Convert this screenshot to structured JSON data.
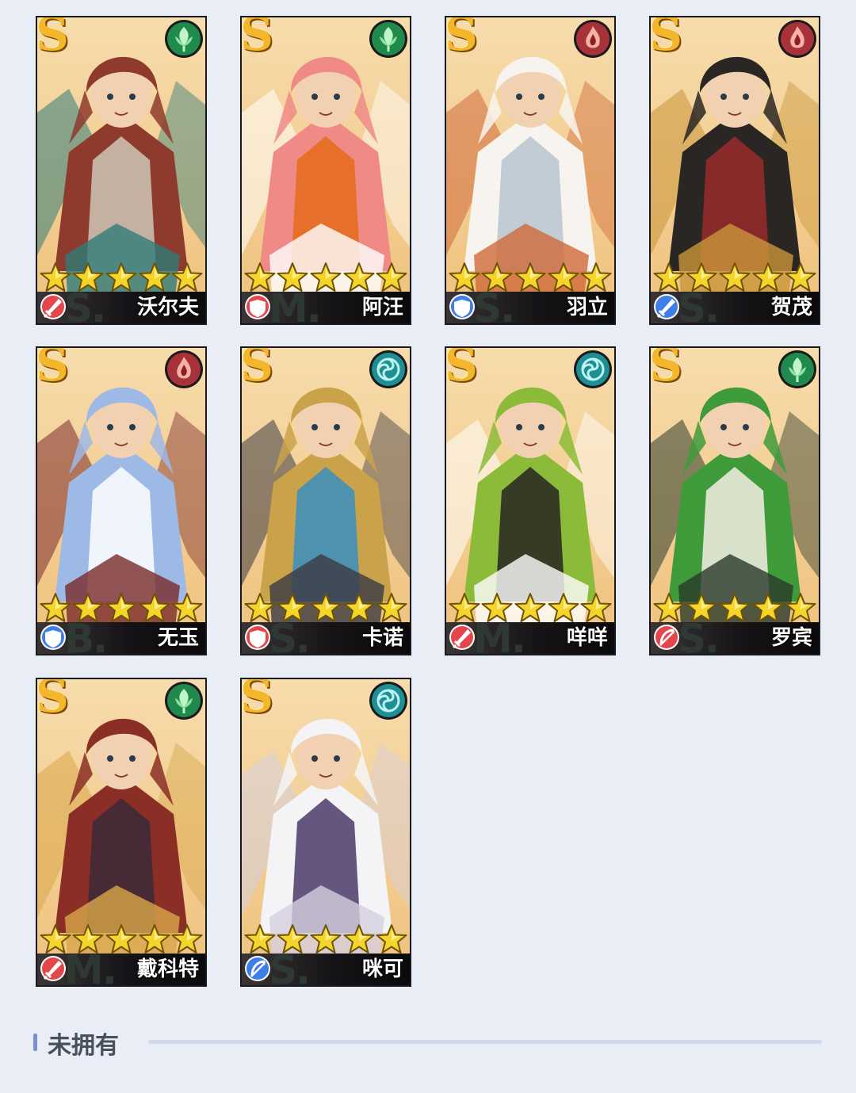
{
  "heroes": [
    {
      "name": "沃尔夫",
      "rank": "S",
      "tier": "S.",
      "element": "nature",
      "element_color": "#1f8a4b",
      "role": "attack",
      "role_color": "#e4464c",
      "stars": 5,
      "art_colors": [
        "#8e3a2c",
        "#cfc7b6",
        "#2f7c7a"
      ]
    },
    {
      "name": "阿汪",
      "rank": "S",
      "tier": "M.",
      "element": "nature",
      "element_color": "#1f8a4b",
      "role": "defense",
      "role_color": "#e4464c",
      "stars": 5,
      "art_colors": [
        "#f08a86",
        "#e46a1a",
        "#ffffff"
      ]
    },
    {
      "name": "羽立",
      "rank": "S",
      "tier": "S.",
      "element": "fire",
      "element_color": "#a8323a",
      "role": "defense",
      "role_color": "#3f7ee6",
      "stars": 5,
      "art_colors": [
        "#f7f4ef",
        "#b8c4cf",
        "#d06a3a"
      ]
    },
    {
      "name": "贺茂",
      "rank": "S",
      "tier": "S.",
      "element": "fire",
      "element_color": "#a8323a",
      "role": "attack",
      "role_color": "#3f7ee6",
      "stars": 5,
      "art_colors": [
        "#2a2624",
        "#9a2b2b",
        "#c9963a"
      ]
    },
    {
      "name": "无玉",
      "rank": "S",
      "tier": "B.",
      "element": "fire",
      "element_color": "#a8323a",
      "role": "defense",
      "role_color": "#3f7ee6",
      "stars": 5,
      "art_colors": [
        "#9db9e6",
        "#ffffff",
        "#7a2a2a"
      ]
    },
    {
      "name": "卡诺",
      "rank": "S",
      "tier": "S.",
      "element": "wind",
      "element_color": "#1e8f93",
      "role": "defense",
      "role_color": "#e4464c",
      "stars": 5,
      "art_colors": [
        "#c9a24a",
        "#3a8fc0",
        "#3b3a44"
      ]
    },
    {
      "name": "咩咩",
      "rank": "S",
      "tier": "M.",
      "element": "wind",
      "element_color": "#1e8f93",
      "role": "attack",
      "role_color": "#e4464c",
      "stars": 5,
      "art_colors": [
        "#8cbb3a",
        "#262422",
        "#ffffff"
      ]
    },
    {
      "name": "罗宾",
      "rank": "S",
      "tier": "S.",
      "element": "nature",
      "element_color": "#1f8a4b",
      "role": "archer",
      "role_color": "#e4464c",
      "stars": 5,
      "art_colors": [
        "#3f9a3a",
        "#f3efe4",
        "#2a3a2a"
      ]
    },
    {
      "name": "戴科特",
      "rank": "S",
      "tier": "M.",
      "element": "nature",
      "element_color": "#1f8a4b",
      "role": "attack",
      "role_color": "#e4464c",
      "stars": 5,
      "art_colors": [
        "#8a2e26",
        "#3a2a3a",
        "#d8a64a"
      ]
    },
    {
      "name": "咪可",
      "rank": "S",
      "tier": "S.",
      "element": "wind",
      "element_color": "#1e8f93",
      "role": "archer",
      "role_color": "#3f7ee6",
      "stars": 5,
      "art_colors": [
        "#f4f4f6",
        "#4a3a6a",
        "#d6cfe0"
      ]
    }
  ],
  "section": {
    "title": "未拥有"
  },
  "colors": {
    "background": "#e9edf6",
    "star": "#f6d52a",
    "accent": "#7c8fd0"
  }
}
